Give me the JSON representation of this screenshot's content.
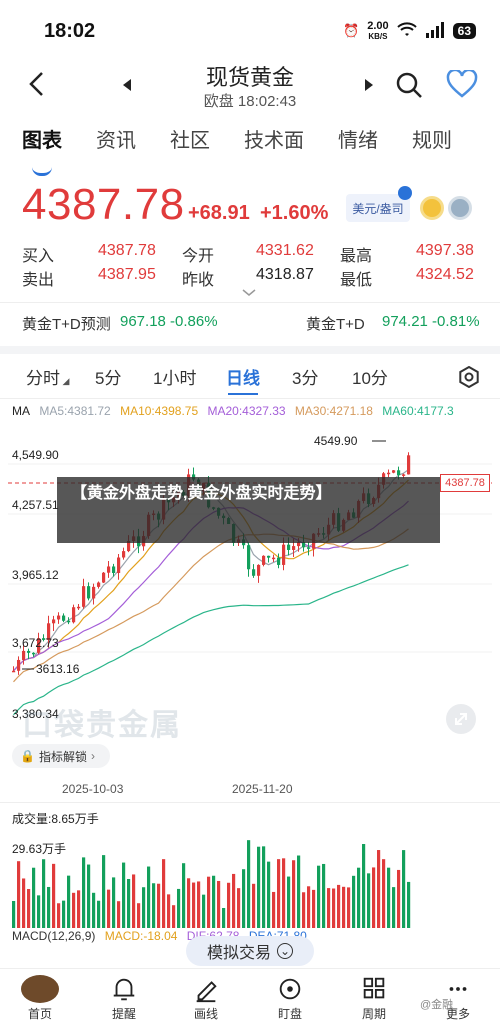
{
  "status": {
    "time": "18:02",
    "net_speed_top": "2.00",
    "net_speed_bottom": "KB/S",
    "battery": "63"
  },
  "header": {
    "title": "现货黄金",
    "market": "欧盘",
    "clock": "18:02:43"
  },
  "tabs": [
    "图表",
    "资讯",
    "社区",
    "技术面",
    "情绪",
    "规则"
  ],
  "price": {
    "last": "4387.78",
    "change": "+68.91",
    "change_pct": "+1.60%",
    "currency_button": "美元/盎司"
  },
  "quote": {
    "buy_label": "买入",
    "buy": "4387.78",
    "sell_label": "卖出",
    "sell": "4387.95",
    "open_label": "今开",
    "open": "4331.62",
    "prev_close_label": "昨收",
    "prev_close": "4318.87",
    "high_label": "最高",
    "high": "4397.38",
    "low_label": "最低",
    "low": "4324.52"
  },
  "predict": {
    "left_label": "黄金T+D预测",
    "left_value": "967.18 -0.86%",
    "right_label": "黄金T+D",
    "right_value": "974.21 -0.81%"
  },
  "periods": [
    "分时",
    "5分",
    "1小时",
    "日线",
    "3分",
    "10分"
  ],
  "ma": {
    "label": "MA",
    "ma5": "MA5:4381.72",
    "ma10": "MA10:4398.75",
    "ma20": "MA20:4327.33",
    "ma30": "MA30:4271.18",
    "ma60": "MA60:4177.3",
    "colors": {
      "ma5": "#9aa3ad",
      "ma10": "#e2a11e",
      "ma20": "#a45ed8",
      "ma30": "#d59a5d",
      "ma60": "#2ab58a"
    }
  },
  "chart_data": {
    "type": "candlestick",
    "y_ticks": [
      "4,549.90",
      "4,257.51",
      "3,965.12",
      "3,672.73",
      "3,380.34"
    ],
    "max_marker": "4549.90",
    "min_marker": "3613.16",
    "last_price_tag": "4387.78",
    "x_ticks": [
      "2025-10-03",
      "2025-11-20"
    ],
    "up_color": "#e03b3b",
    "down_color": "#13a05c"
  },
  "indicator_button": "指标解锁",
  "volume": {
    "label": "成交量:8.65万手",
    "axis_top": "29.63万手"
  },
  "macd": {
    "label": "MACD(12,26,9)",
    "macd": "MACD:-18.04",
    "dif": "DIF:62.78",
    "dea": "DEA:71.80"
  },
  "sim_trade": "模拟交易",
  "nav": [
    "首页",
    "提醒",
    "画线",
    "盯盘",
    "周期",
    "更多"
  ],
  "news_banner": "【黄金外盘走势,黄金外盘实时走势】",
  "watermark": "口袋贵金属",
  "corner_watermark": "@金融"
}
